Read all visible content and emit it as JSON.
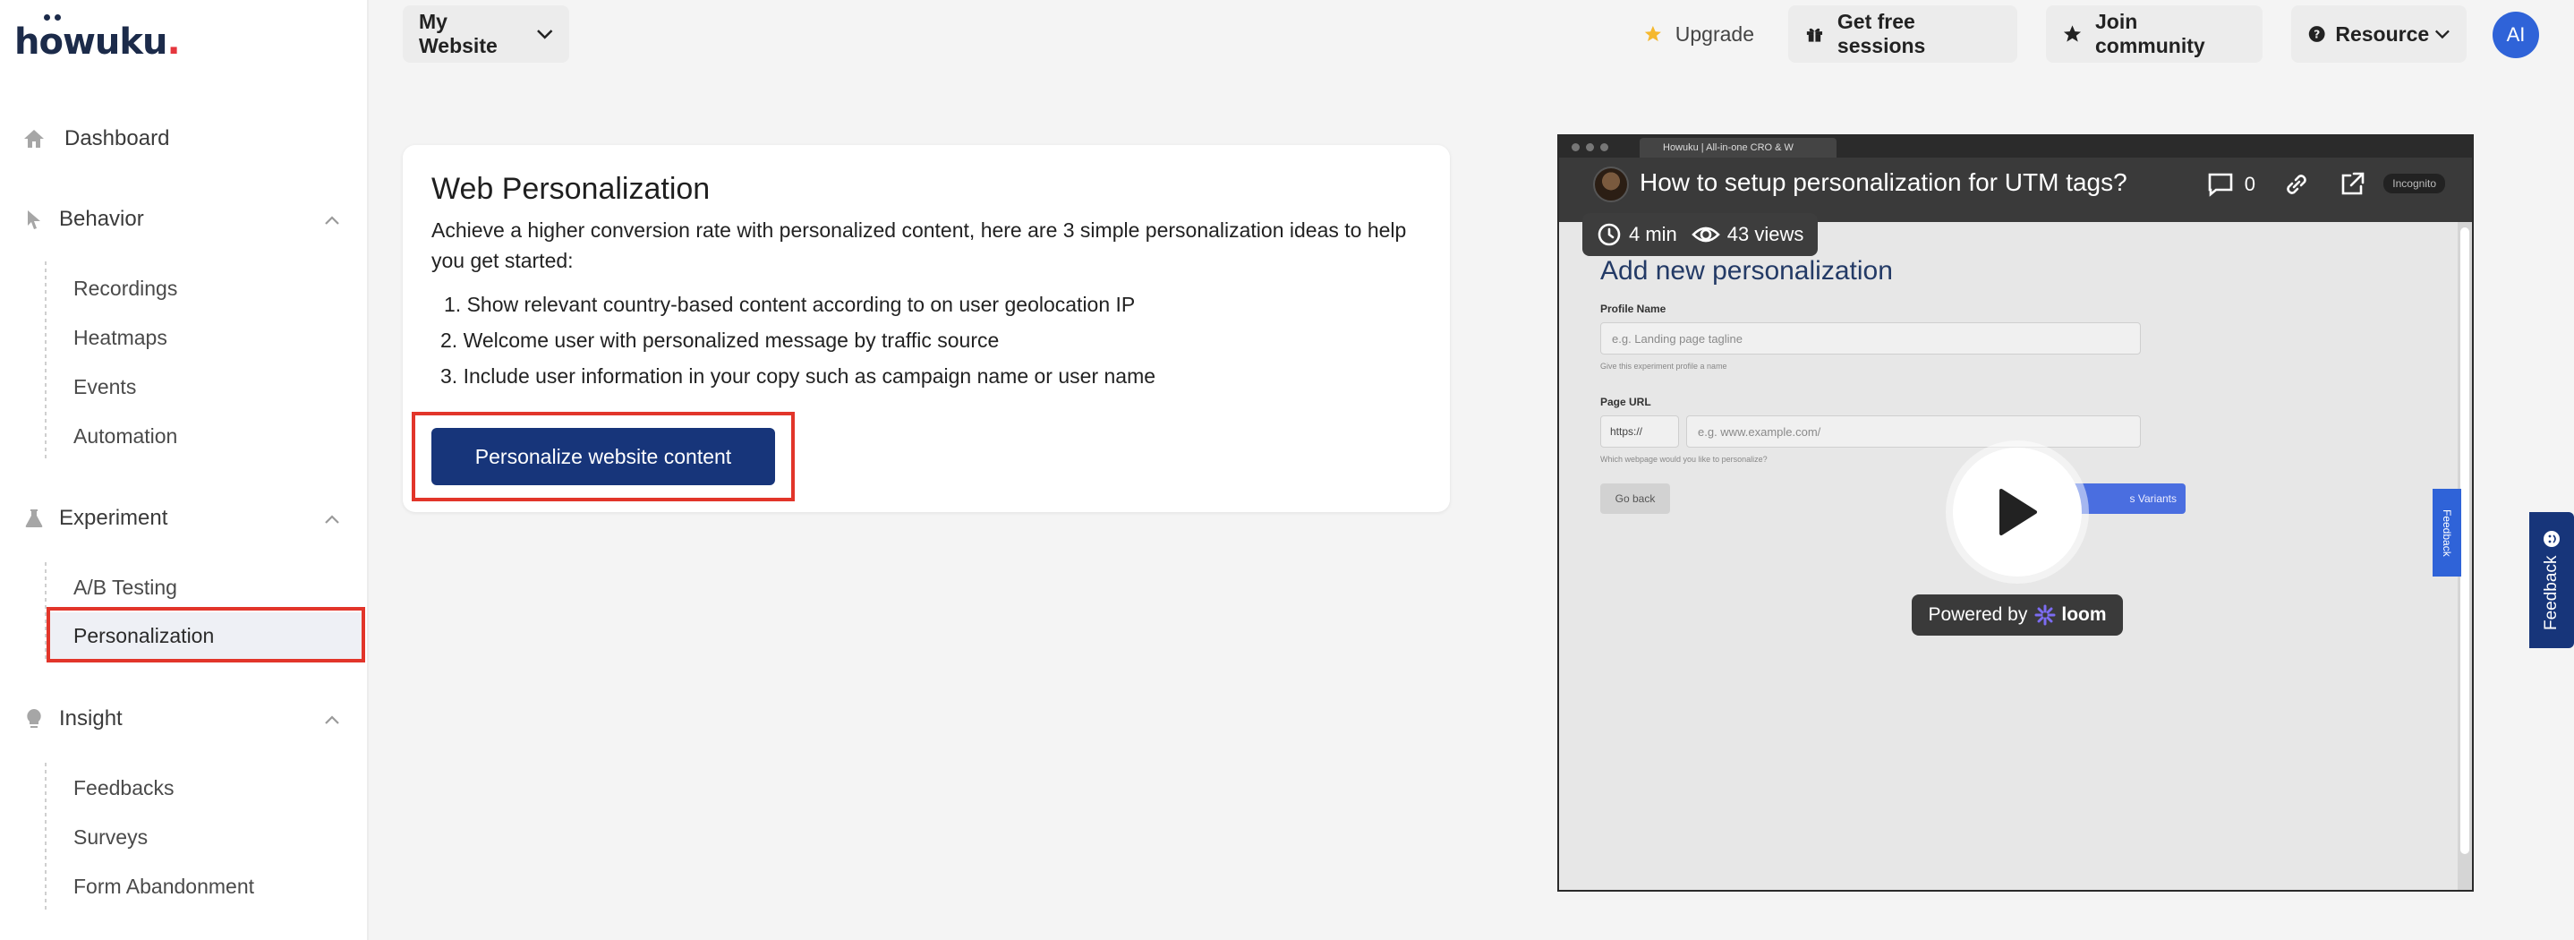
{
  "app": {
    "logo_text": "howuku",
    "logo_dot": "."
  },
  "sidebar": {
    "dashboard": "Dashboard",
    "behavior": {
      "label": "Behavior",
      "items": [
        "Recordings",
        "Heatmaps",
        "Events",
        "Automation"
      ]
    },
    "experiment": {
      "label": "Experiment",
      "items": [
        "A/B Testing",
        "Personalization"
      ],
      "active": "Personalization"
    },
    "insight": {
      "label": "Insight",
      "items": [
        "Feedbacks",
        "Surveys",
        "Form Abandonment"
      ]
    }
  },
  "topbar": {
    "website_selector": "My Website",
    "upgrade": "Upgrade",
    "free_sessions": "Get free sessions",
    "join_community": "Join community",
    "resource": "Resource",
    "avatar_initials": "AI"
  },
  "card": {
    "title": "Web Personalization",
    "description": "Achieve a higher conversion rate with personalized content, here are 3 simple personalization ideas to help you get started:",
    "ideas": [
      "1. Show relevant country-based content according to on user geolocation IP",
      "2. Welcome user with personalized message by traffic source",
      "3. Include user information in your copy such as campaign name or user name"
    ],
    "cta": "Personalize website content"
  },
  "video": {
    "title": "How to setup personalization for UTM tags?",
    "comments": "0",
    "duration": "4 min",
    "views": "43 views",
    "browser_tab": "Howuku | All-in-one CRO & W",
    "incognito": "Incognito",
    "form_heading": "Add new personalization",
    "profile_label": "Profile Name",
    "profile_placeholder": "e.g. Landing page tagline",
    "profile_hint": "Give this experiment profile a name",
    "url_label": "Page URL",
    "url_protocol": "https://",
    "url_placeholder": "e.g. www.example.com/",
    "url_hint": "Which webpage would you like to personalize?",
    "back_button": "Go back",
    "next_button": "s Variants",
    "feedback_tab": "Feedback",
    "powered_by": "Powered by",
    "brand": "loom"
  },
  "feedback_tab": "Feedback",
  "colors": {
    "primary": "#17357a",
    "highlight": "#e2352a",
    "avatar": "#2f63d8",
    "star": "#f5b82e"
  }
}
